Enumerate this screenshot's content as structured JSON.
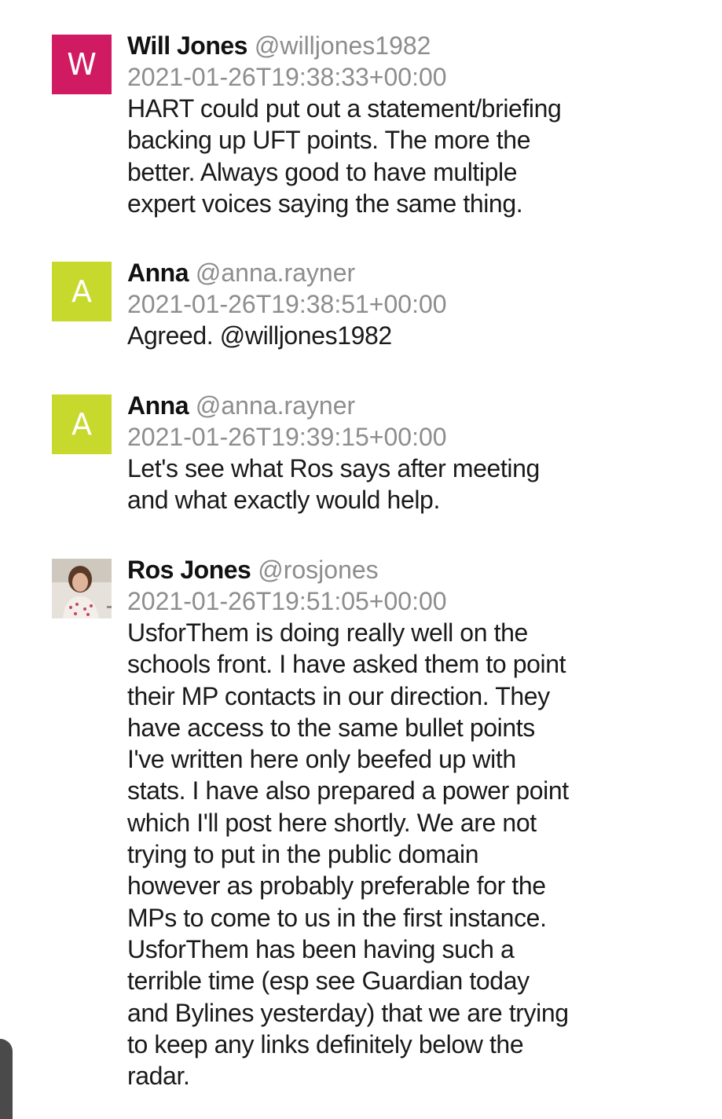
{
  "posts": [
    {
      "avatar_letter": "W",
      "avatar_color": "#d01b63",
      "name": "Will Jones",
      "handle": "@willjones1982",
      "timestamp": "2021-01-26T19:38:33+00:00",
      "lines": [
        "HART could put out a statement/briefing",
        "backing up UFT points. The more the",
        "better. Always good to have multiple",
        "expert voices saying the same thing."
      ]
    },
    {
      "avatar_letter": "A",
      "avatar_color": "#c6d92c",
      "name": "Anna",
      "handle": "@anna.rayner",
      "timestamp": "2021-01-26T19:38:51+00:00",
      "lines": [
        "Agreed. @willjones1982"
      ]
    },
    {
      "avatar_letter": "A",
      "avatar_color": "#c6d92c",
      "name": "Anna",
      "handle": "@anna.rayner",
      "timestamp": "2021-01-26T19:39:15+00:00",
      "lines": [
        "Let's see what Ros says after meeting",
        "and what exactly would help."
      ]
    },
    {
      "avatar_letter": "",
      "avatar_color": "#d9d2cb",
      "name": "Ros Jones",
      "handle": "@rosjones",
      "timestamp": "2021-01-26T19:51:05+00:00",
      "lines": [
        "UsforThem is doing really well on the",
        "schools front. I have asked them to point",
        "their MP contacts in our direction. They",
        "have access to the same bullet points",
        "I've written here only beefed up with",
        "stats. I have also prepared a power point",
        "which I'll post here shortly. We are not",
        "trying to put in the public domain",
        "however as probably preferable for the",
        "MPs to come to us in the first instance.",
        "UsforThem has been having such a",
        "terrible time (esp see Guardian today",
        "and Bylines yesterday) that we are trying",
        "to keep any links definitely below the",
        "radar."
      ]
    }
  ]
}
